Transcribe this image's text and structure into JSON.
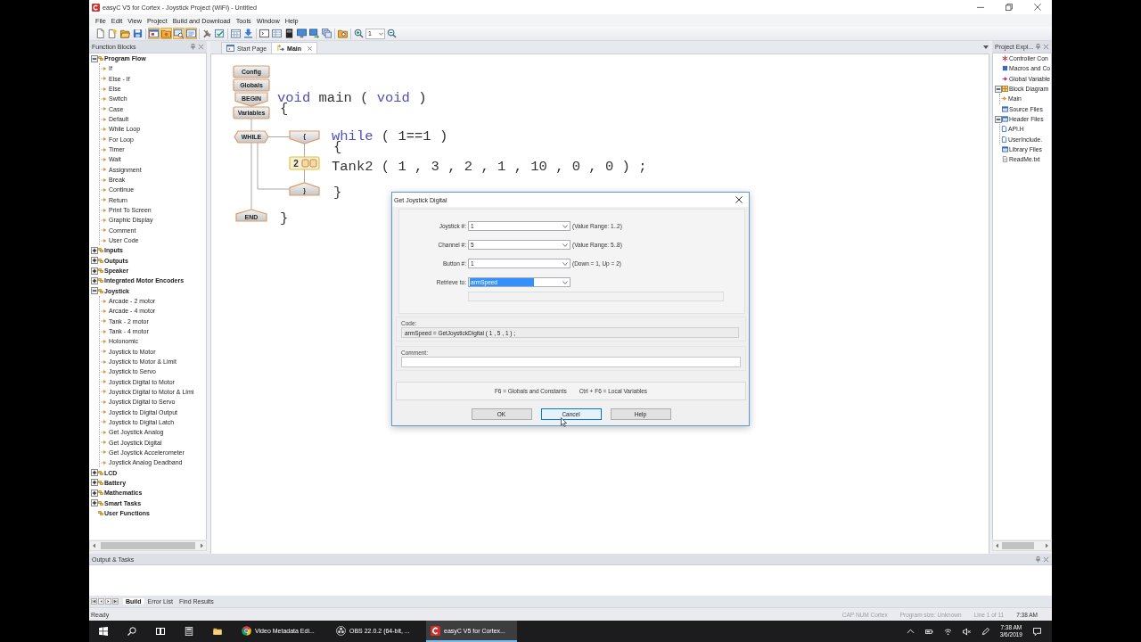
{
  "window": {
    "title": "easyC V5 for Cortex - Joystick Project (WiFi) - Untitled"
  },
  "menu": [
    "File",
    "Edit",
    "View",
    "Project",
    "Build and Download",
    "Tools",
    "Window",
    "Help"
  ],
  "toolbar": {
    "buttons": [
      {
        "kind": "new",
        "checked": false
      },
      {
        "kind": "newproject",
        "checked": false
      },
      {
        "kind": "open",
        "checked": false
      },
      {
        "kind": "save",
        "checked": false
      },
      {
        "kind": "window",
        "checked": true
      },
      {
        "kind": "folder",
        "checked": true
      },
      {
        "kind": "inspect",
        "checked": true
      },
      {
        "kind": "panel",
        "checked": true
      },
      {
        "kind": "tools",
        "checked": false
      },
      {
        "kind": "check",
        "checked": false
      },
      {
        "kind": "calendar",
        "checked": false
      },
      {
        "kind": "download",
        "checked": false
      },
      {
        "kind": "terminal",
        "checked": false
      },
      {
        "kind": "table",
        "checked": false
      },
      {
        "kind": "device",
        "checked": false
      },
      {
        "kind": "screen",
        "checked": false
      },
      {
        "kind": "transfer",
        "checked": false
      },
      {
        "kind": "stack",
        "checked": false
      },
      {
        "kind": "browse",
        "checked": false
      },
      {
        "kind": "zoomin",
        "checked": false
      },
      {
        "kind": "zoomout",
        "checked": false
      }
    ],
    "zoom": {
      "value": "1"
    }
  },
  "function_blocks": {
    "title": "Function Blocks",
    "tree": [
      {
        "label": "Program Flow",
        "kind": "folder",
        "expanded": true,
        "children": [
          "If",
          "Else - If",
          "Else",
          "Switch",
          "Case",
          "Default",
          "While Loop",
          "For Loop",
          "Timer",
          "Wait",
          "Assignment",
          "Break",
          "Continue",
          "Return",
          "Print To Screen",
          "Graphic Display",
          "Comment",
          "User Code"
        ]
      },
      {
        "label": "Inputs",
        "kind": "folder",
        "expanded": false
      },
      {
        "label": "Outputs",
        "kind": "folder",
        "expanded": false
      },
      {
        "label": "Speaker",
        "kind": "folder",
        "expanded": false
      },
      {
        "label": "Integrated Motor Encoders",
        "kind": "folder",
        "expanded": false
      },
      {
        "label": "Joystick",
        "kind": "folder",
        "expanded": true,
        "children": [
          "Arcade - 2 motor",
          "Arcade - 4 motor",
          "Tank - 2 motor",
          "Tank - 4 motor",
          "Holonomic",
          "Joystick to Motor",
          "Joystick to Motor & Limit",
          "Joystick to Servo",
          "Joystick Digital to Motor",
          "Joystick Digital to Motor & Limi",
          "Joystick Digital to Servo",
          "Joystick to Digital Output",
          "Joystick to Digital Latch",
          "Get Joystick Analog",
          "Get Joystick Digital",
          "Get Joystick Accelerometer",
          "Joystick Analog Deadband"
        ]
      },
      {
        "label": "LCD",
        "kind": "folder",
        "expanded": false
      },
      {
        "label": "Battery",
        "kind": "folder",
        "expanded": false
      },
      {
        "label": "Mathematics",
        "kind": "folder",
        "expanded": false
      },
      {
        "label": "Smart Tasks",
        "kind": "folder",
        "expanded": false
      },
      {
        "label": "User Functions",
        "kind": "plain"
      }
    ]
  },
  "tabs": [
    {
      "label": "Start Page",
      "kind": "start",
      "selected": false
    },
    {
      "label": "Main",
      "kind": "diagram",
      "selected": true
    }
  ],
  "canvas": {
    "blocks": [
      {
        "kind": "rect",
        "label": "Config",
        "selected": false
      },
      {
        "kind": "rect",
        "label": "Globals",
        "selected": false
      },
      {
        "kind": "begin",
        "label": "BEGIN",
        "selected": false
      },
      {
        "kind": "rect",
        "label": "Variables",
        "selected": false
      },
      {
        "kind": "loop",
        "label": "WHILE",
        "selected": false
      },
      {
        "kind": "begin",
        "label": "{",
        "selected": false
      },
      {
        "kind": "function",
        "label": "2",
        "selected": true
      },
      {
        "kind": "end",
        "label": "}",
        "selected": false
      },
      {
        "kind": "end",
        "label": "END",
        "selected": false
      }
    ],
    "code": [
      {
        "tokens": [
          {
            "text": "void",
            "kind": "keyword"
          },
          {
            "text": "main (",
            "kind": "plain"
          },
          {
            "text": "void",
            "kind": "keyword"
          },
          {
            "text": ")",
            "kind": "plain"
          }
        ]
      },
      {
        "tokens": [
          {
            "text": "{",
            "kind": "plain"
          }
        ]
      },
      {
        "tokens": [
          {
            "text": "while",
            "kind": "keyword"
          },
          {
            "text": "( 1==1 )",
            "kind": "plain"
          }
        ]
      },
      {
        "tokens": [
          {
            "text": "{",
            "kind": "plain"
          }
        ]
      },
      {
        "tokens": [
          {
            "text": "Tank2 ( 1 , 3 , 2 , 1 , 10 , 0 , 0 ) ;",
            "kind": "plain"
          }
        ]
      },
      {
        "tokens": [
          {
            "text": "}",
            "kind": "plain"
          }
        ]
      },
      {
        "tokens": [
          {
            "text": "}",
            "kind": "plain"
          }
        ]
      }
    ]
  },
  "project_explorer": {
    "title": "Project Expl...",
    "items": [
      {
        "label": "Controller Con",
        "kind": "config"
      },
      {
        "label": "Macros and Co",
        "kind": "macro"
      },
      {
        "label": "Global Variable",
        "kind": "variable"
      },
      {
        "label": "Block Diagram",
        "kind": "diagram",
        "expanded": true,
        "children": [
          {
            "label": "Main",
            "kind": "block"
          }
        ]
      },
      {
        "label": "Source Files",
        "kind": "folder"
      },
      {
        "label": "Header Files",
        "kind": "folder",
        "expanded": true,
        "children": [
          {
            "label": "API.H",
            "kind": "file"
          },
          {
            "label": "UserInclude.",
            "kind": "file"
          }
        ]
      },
      {
        "label": "Library Files",
        "kind": "folder"
      },
      {
        "label": "ReadMe.txt",
        "kind": "text"
      }
    ]
  },
  "dialog": {
    "title": "Get Joystick Digital",
    "fields": [
      {
        "label": "Joystick #:",
        "value": "1",
        "hint": "(Value Range: 1..2)",
        "highlighted": false
      },
      {
        "label": "Channel #:",
        "value": "5",
        "hint": "(Value Range: 5..8)",
        "highlighted": false
      },
      {
        "label": "Button #:",
        "value": "1",
        "hint": "(Down = 1, Up = 2)",
        "highlighted": false
      },
      {
        "label": "Retrieve to:",
        "value": "armSpeed",
        "highlighted": true
      }
    ],
    "code_label": "Code:",
    "code": "armSpeed = GetJoystickDigital ( 1 , 5 , 1 ) ;",
    "comment_label": "Comment:",
    "shortcuts": [
      "F6 = Globals and Constants",
      "Ctrl + F6 = Local Variables"
    ],
    "buttons": [
      {
        "label": "OK",
        "hovered": false
      },
      {
        "label": "Cancel",
        "hovered": true
      },
      {
        "label": "Help",
        "hovered": false
      }
    ]
  },
  "output": {
    "title": "Output & Tasks",
    "tabs": [
      {
        "label": "Build",
        "selected": true
      },
      {
        "label": "Error List",
        "selected": false
      },
      {
        "label": "Find Results",
        "selected": false
      }
    ]
  },
  "status_bar": {
    "text": "Ready",
    "panes": [
      {
        "text": "CAP NUM Cortex",
        "disabled": true
      },
      {
        "text": "Program size: Unknown",
        "disabled": true
      },
      {
        "text": "Line 1 of 11",
        "disabled": true
      },
      {
        "text": "7:38 AM",
        "disabled": false
      }
    ]
  },
  "taskbar": {
    "tasks": [
      {
        "kind": "chrome",
        "label": "Video Metadata Edi...",
        "selected": false
      },
      {
        "kind": "obs",
        "label": "OBS 22.0.2 (64-bit, ...",
        "selected": false
      },
      {
        "kind": "easyc",
        "label": "easyC V5 for Cortex...",
        "selected": true
      }
    ],
    "clock": {
      "time": "7:38 AM",
      "date": "3/6/2019"
    }
  }
}
